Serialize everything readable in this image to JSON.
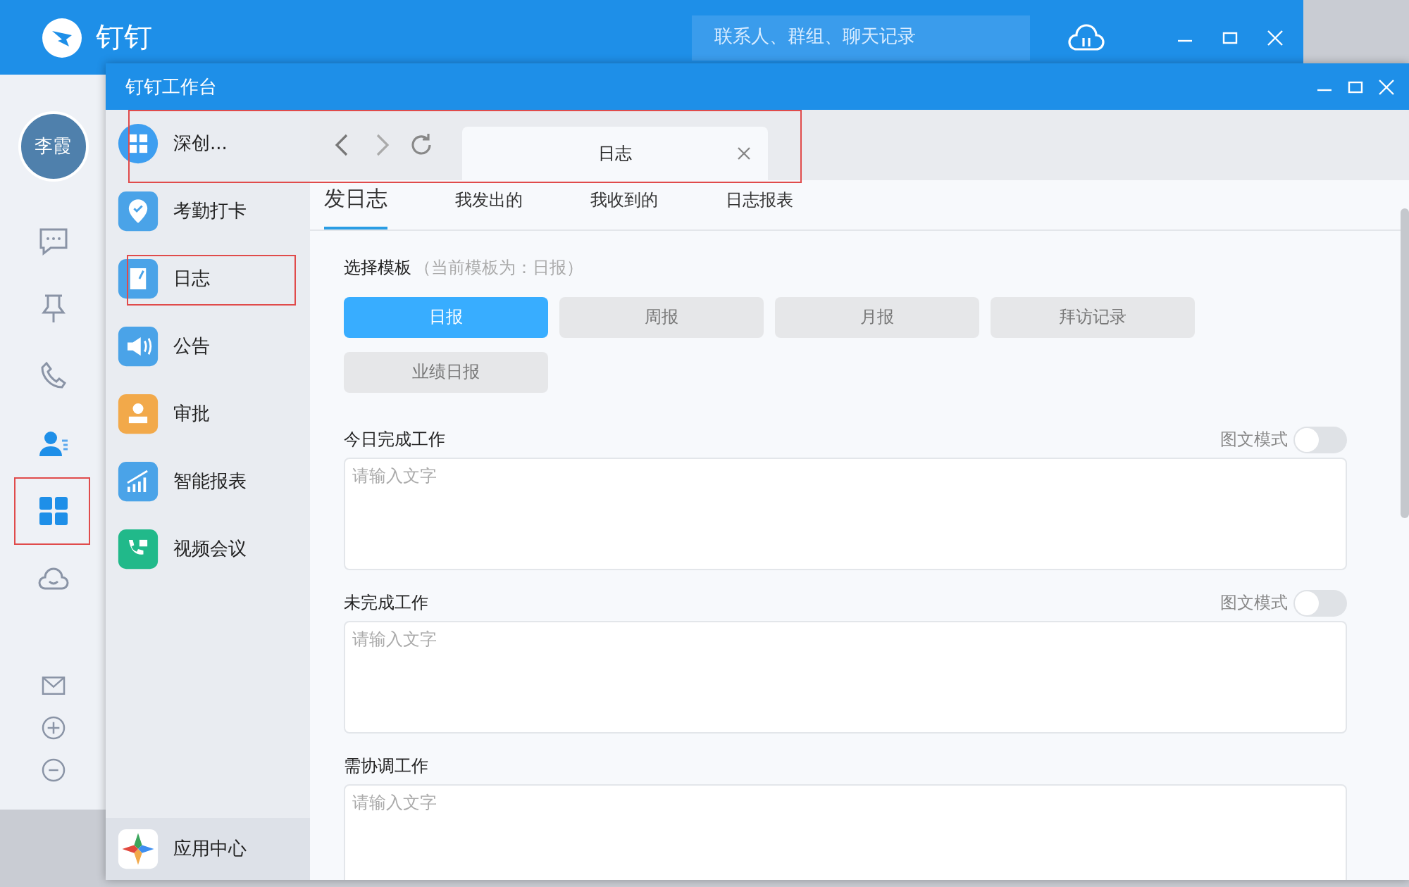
{
  "app": {
    "name": "钉钉",
    "search": {
      "placeholder": "联系人、群组、聊天记录"
    }
  },
  "user": {
    "avatar": "李霞"
  },
  "rail": [
    {
      "kind": "chat",
      "selected": false,
      "highlighted": false
    },
    {
      "kind": "pin",
      "selected": false,
      "highlighted": false
    },
    {
      "kind": "phone",
      "selected": false,
      "highlighted": false
    },
    {
      "kind": "contacts",
      "selected": false,
      "highlighted": false
    },
    {
      "kind": "apps",
      "selected": true,
      "highlighted": true
    },
    {
      "kind": "cloud",
      "selected": false,
      "highlighted": false
    }
  ],
  "rail_bottom": [
    {
      "kind": "mail"
    },
    {
      "kind": "add"
    },
    {
      "kind": "more"
    }
  ],
  "workbench": {
    "title": "钉钉工作台",
    "apps": [
      {
        "label": "深创...",
        "kind": "org",
        "color": "#3d9ef0",
        "highlighted": false
      },
      {
        "label": "考勤打卡",
        "kind": "attendance",
        "color": "#4aa3e8",
        "highlighted": false
      },
      {
        "label": "日志",
        "kind": "log",
        "color": "#4aa3e8",
        "highlighted": true
      },
      {
        "label": "公告",
        "kind": "notice",
        "color": "#4aa3e8",
        "highlighted": false
      },
      {
        "label": "审批",
        "kind": "approval",
        "color": "#f2a94a",
        "highlighted": false
      },
      {
        "label": "智能报表",
        "kind": "report",
        "color": "#4aa3e8",
        "highlighted": false
      },
      {
        "label": "视频会议",
        "kind": "video",
        "color": "#21b98a",
        "highlighted": false
      }
    ],
    "footer": {
      "label": "应用中心"
    }
  },
  "browser": {
    "highlighted": true,
    "tab": {
      "label": "日志"
    }
  },
  "subtabs": [
    {
      "label": "发日志",
      "selected": true
    },
    {
      "label": "我发出的",
      "selected": false
    },
    {
      "label": "我收到的",
      "selected": false
    },
    {
      "label": "日志报表",
      "selected": false
    }
  ],
  "template": {
    "label": "选择模板",
    "hint": "（当前模板为：日报）",
    "options": [
      {
        "label": "日报",
        "selected": true
      },
      {
        "label": "周报",
        "selected": false
      },
      {
        "label": "月报",
        "selected": false
      },
      {
        "label": "拜访记录",
        "selected": false
      },
      {
        "label": "业绩日报",
        "selected": false
      }
    ]
  },
  "sections": [
    {
      "label": "今日完成工作",
      "toggle": {
        "label": "图文模式",
        "on": false
      },
      "placeholder": "请输入文字"
    },
    {
      "label": "未完成工作",
      "toggle": {
        "label": "图文模式",
        "on": false
      },
      "placeholder": "请输入文字"
    },
    {
      "label": "需协调工作",
      "placeholder": "请输入文字"
    }
  ]
}
